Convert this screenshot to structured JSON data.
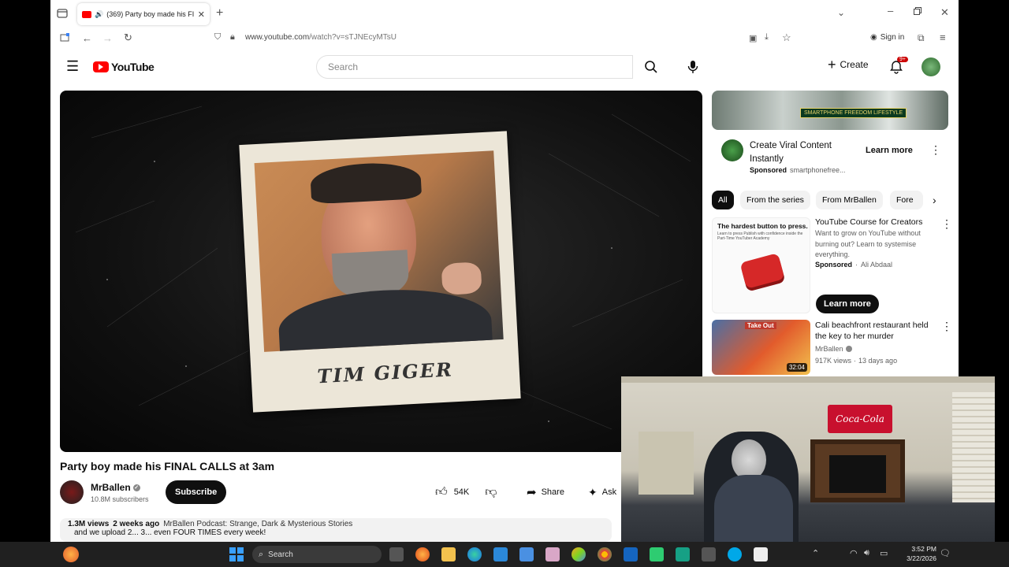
{
  "browser": {
    "tab_title": "(369) Party boy made his FI",
    "url_host": "www.youtube.com",
    "url_path": "/watch?v=sTJNEcyMTsU",
    "sign_in": "Sign in"
  },
  "youtube": {
    "logo_text": "YouTube",
    "search_placeholder": "Search",
    "create_label": "Create",
    "notif_count": "9+"
  },
  "video": {
    "caption": "TIM GIGER",
    "title": "Party boy made his FINAL CALLS at 3am",
    "channel": "MrBallen",
    "subscribers": "10.8M subscribers",
    "subscribe": "Subscribe",
    "likes": "54K",
    "share": "Share",
    "ask": "Ask",
    "views": "1.3M views",
    "age": "2 weeks ago",
    "podcast": "MrBallen Podcast: Strange, Dark & Mysterious Stories",
    "desc_line2": "and we upload 2... 3... even FOUR TIMES every week!"
  },
  "sidebar": {
    "ad_banner_text": "SMARTPHONE FREEDOM LIFESTYLE",
    "ad_title": "Create Viral Content Instantly",
    "ad_sponsored": "Sponsored",
    "ad_domain": "smartphonefree...",
    "ad_cta": "Learn more",
    "chips": [
      "All",
      "From the series",
      "From MrBallen",
      "Fore"
    ],
    "items": [
      {
        "thumb_head": "The hardest button to press.",
        "thumb_sub": "Learn to press Publish with confidence inside the Part-Time YouTuber Academy",
        "title": "YouTube Course for Creators",
        "desc": "Want to grow on YouTube without burning out? Learn to systemise everything.",
        "sponsored": "Sponsored",
        "advertiser": "Ali Abdaal",
        "cta": "Learn more"
      },
      {
        "thumb_text": "Take Out",
        "duration": "32:04",
        "title": "Cali beachfront restaurant held the key to her murder",
        "channel": "MrBallen",
        "views": "917K views",
        "age": "13 days ago"
      }
    ]
  },
  "webcam": {
    "sign_text": "Coca-Cola"
  },
  "taskbar": {
    "search": "Search",
    "time": "3:52 PM",
    "date": "3/22/2026"
  }
}
